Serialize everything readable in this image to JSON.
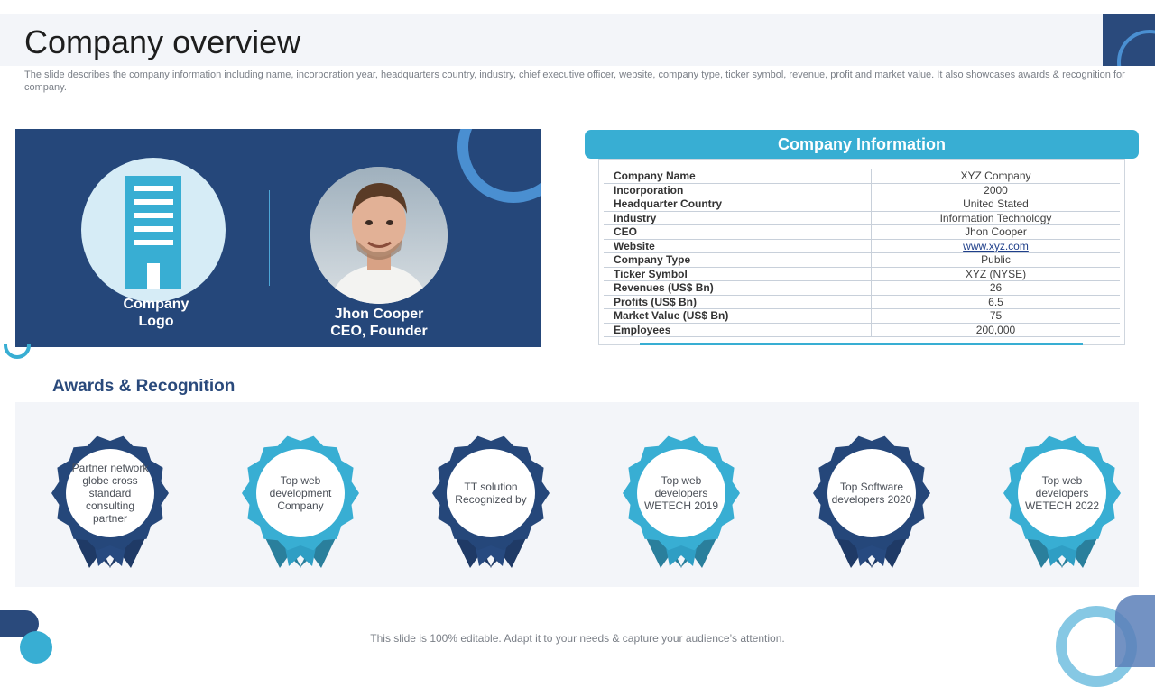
{
  "title": "Company overview",
  "description": "The slide describes the company information including name, incorporation year, headquarters country, industry, chief executive officer, website, company type, ticker symbol, revenue, profit and market value. It also showcases awards & recognition for company.",
  "hero": {
    "logo_label_line1": "Company",
    "logo_label_line2": "Logo",
    "ceo_name": "Jhon Cooper",
    "ceo_role": "CEO, Founder"
  },
  "company_info": {
    "header": "Company Information",
    "rows": [
      {
        "label": "Company Name",
        "value": "XYZ  Company"
      },
      {
        "label": "Incorporation",
        "value": "2000"
      },
      {
        "label": "Headquarter Country",
        "value": "United Stated"
      },
      {
        "label": "Industry",
        "value": "Information Technology"
      },
      {
        "label": "CEO",
        "value": "Jhon Cooper"
      },
      {
        "label": "Website",
        "value": "www.xyz.com"
      },
      {
        "label": "Company Type",
        "value": "Public"
      },
      {
        "label": "Ticker Symbol",
        "value": "XYZ  (NYSE)"
      },
      {
        "label": "Revenues (US$ Bn)",
        "value": "26"
      },
      {
        "label": "Profits (US$ Bn)",
        "value": "6.5"
      },
      {
        "label": "Market Value (US$ Bn)",
        "value": "75"
      },
      {
        "label": "Employees",
        "value": "200,000"
      }
    ]
  },
  "awards": {
    "title": "Awards & Recognition",
    "items": [
      {
        "text": "Partner network globe cross standard consulting partner",
        "theme": "dark"
      },
      {
        "text": "Top web development Company",
        "theme": "light"
      },
      {
        "text": "TT solution Recognized by",
        "theme": "dark"
      },
      {
        "text": "Top web developers WETECH 2019",
        "theme": "light"
      },
      {
        "text": "Top Software developers 2020",
        "theme": "dark"
      },
      {
        "text": "Top web developers WETECH 2022",
        "theme": "light"
      }
    ]
  },
  "colors": {
    "navy": "#25477a",
    "accent": "#38aed3",
    "dark_ribbon": "#1f3a66",
    "light_ribbon": "#2a8fb0"
  },
  "footer": "This slide is 100% editable. Adapt it to your needs & capture your audience’s attention."
}
